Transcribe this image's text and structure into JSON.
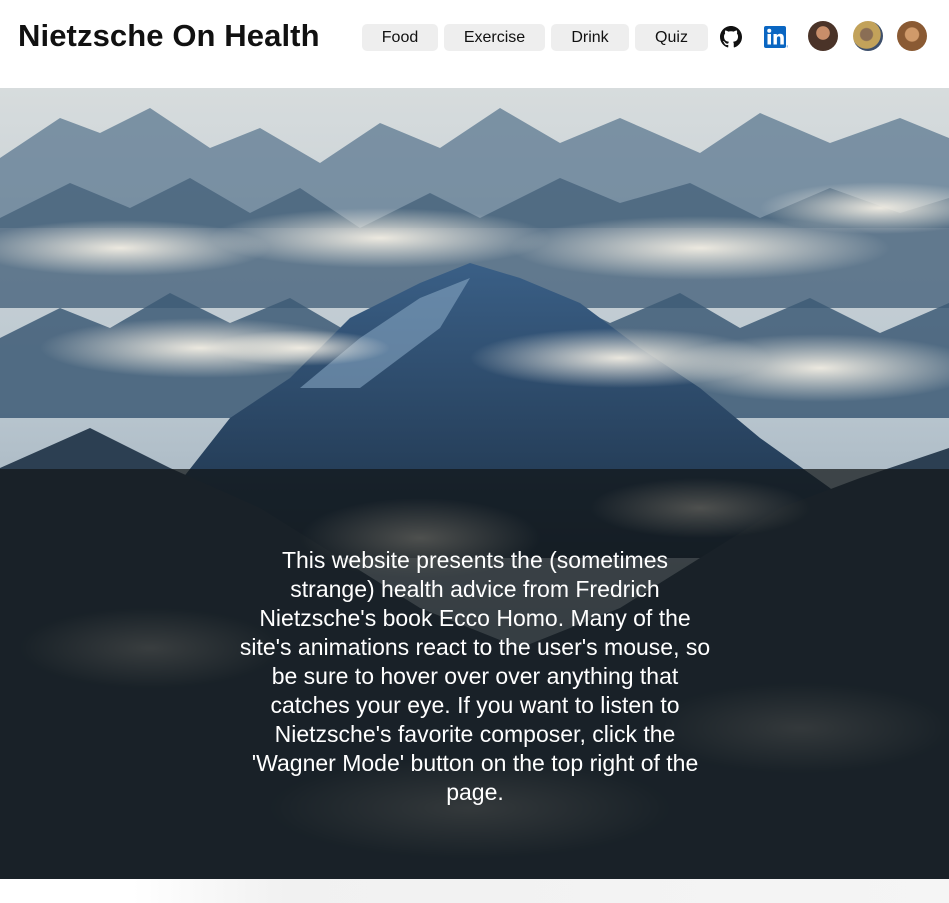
{
  "header": {
    "title": "Nietzsche On Health",
    "nav": [
      {
        "label": "Food"
      },
      {
        "label": "Exercise"
      },
      {
        "label": "Drink"
      },
      {
        "label": "Quiz"
      }
    ],
    "icons": [
      "github-icon",
      "linkedin-icon"
    ],
    "avatars": 3
  },
  "hero": {
    "intro": "This website presents the (sometimes strange) health advice from Fredrich Nietzsche's book Ecco Homo. Many of the site's animations react to the user's mouse, so be sure to hover over over anything that catches your eye. If you want to listen to Nietzsche's favorite composer, click the 'Wagner Mode' button on the top right of the page."
  },
  "colors": {
    "overlay": "#121618",
    "linkedin": "#0a66c2",
    "nav_bg": "#eeeeee"
  }
}
